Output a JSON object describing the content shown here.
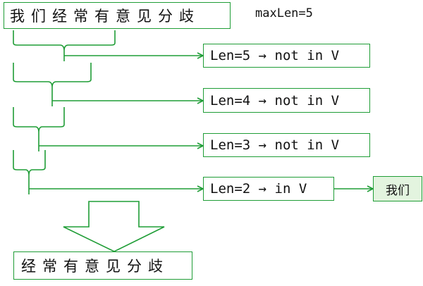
{
  "sentence": "我们经常有意见分歧",
  "max_len_label": "maxLen=5",
  "checks": [
    {
      "label": "Len=5 → not in V"
    },
    {
      "label": "Len=4 → not in V"
    },
    {
      "label": "Len=3 → not in V"
    },
    {
      "label": "Len=2 → in V"
    }
  ],
  "matched_word": "我们",
  "remaining_sentence": "经常有意见分歧",
  "colors": {
    "line": "#1f9d36",
    "result_fill": "#e3f4df"
  }
}
